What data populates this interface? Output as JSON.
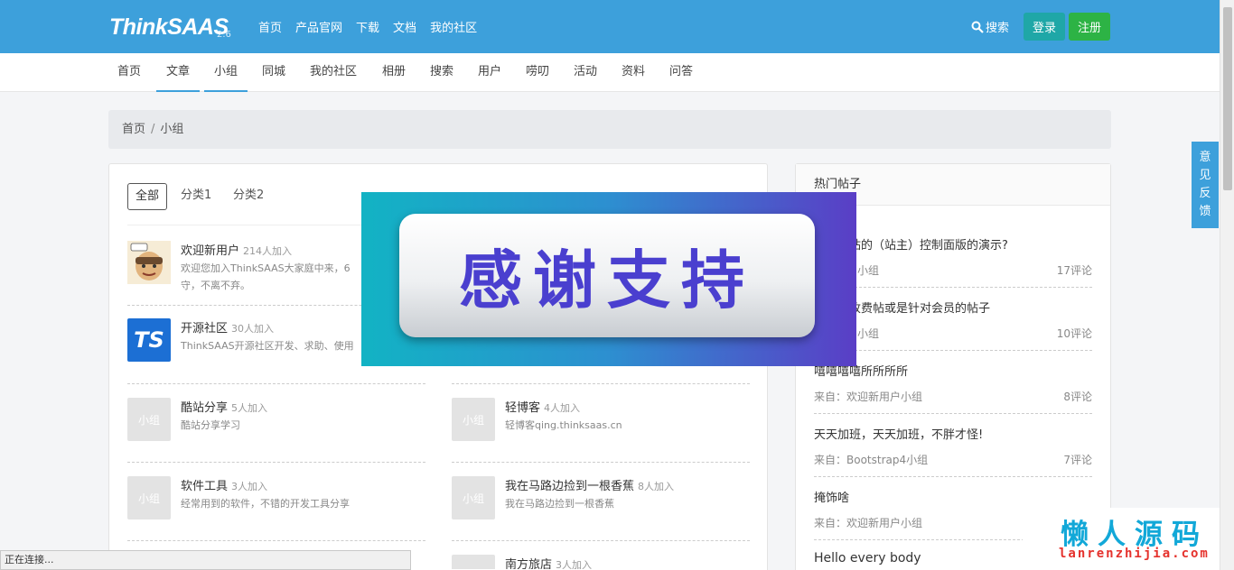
{
  "header": {
    "logo": "ThinkSAAS",
    "version": "2.6",
    "nav": [
      "首页",
      "产品官网",
      "下载",
      "文档",
      "我的社区"
    ],
    "search": "搜索",
    "login": "登录",
    "register": "注册",
    "bg_color": "#3da0db"
  },
  "subnav": [
    "首页",
    "文章",
    "小组",
    "同城",
    "我的社区",
    "相册",
    "搜索",
    "用户",
    "唠叨",
    "活动",
    "资料",
    "问答"
  ],
  "breadcrumb": {
    "home": "首页",
    "sep": "/",
    "current": "小组"
  },
  "filters": [
    "全部",
    "分类1",
    "分类2"
  ],
  "groups": [
    {
      "name": "欢迎新用户",
      "count": "214人加入",
      "desc": "欢迎您加入ThinkSAAS大家庭中来，6",
      "desc2": "守，不离不弃。",
      "thumb": ""
    },
    {
      "name": "开源社区",
      "count": "30人加入",
      "desc": "ThinkSAAS开源社区开发、求助、使用",
      "thumb": "TS"
    },
    {
      "name": "酷站分享",
      "count": "5人加入",
      "desc": "酷站分享学习",
      "thumb": "小组"
    },
    {
      "name": "轻博客",
      "count": "4人加入",
      "desc": "轻博客qing.thinksaas.cn",
      "thumb": "小组"
    },
    {
      "name": "软件工具",
      "count": "3人加入",
      "desc": "经常用到的软件，不错的开发工具分享",
      "thumb": "小组"
    },
    {
      "name": "我在马路边捡到一根香蕉",
      "count": "8人加入",
      "desc": "我在马路边捡到一根香蕉",
      "thumb": "小组"
    },
    {
      "name": "南方旅店",
      "count": "3人加入",
      "desc": "",
      "thumb": "小组"
    }
  ],
  "sidebar": {
    "title": "热门帖子",
    "posts": [
      {
        "title": "这个网站的（站主）控制面版的演示?",
        "from": "迎新用户小组",
        "comments": "17评论"
      },
      {
        "title": "不能设收费帖或是针对会员的帖子",
        "from": "迎新用户小组",
        "comments": "10评论"
      },
      {
        "title": "嘻嘻嘻嘻所所所所",
        "from": "来自：欢迎新用户小组",
        "comments": "8评论"
      },
      {
        "title": "天天加班，天天加班，不胖才怪!",
        "from": "来自：Bootstrap4小组",
        "comments": "7评论"
      },
      {
        "title": "掩饰啥",
        "from": "来自：欢迎新用户小组",
        "comments": ""
      },
      {
        "title": "Hello every body",
        "from": "",
        "comments": ""
      }
    ]
  },
  "feedback": "意见反馈",
  "banner": {
    "text": "感谢支持"
  },
  "status_bar": "正在连接...",
  "watermark": {
    "main": "懒人源码",
    "sub": "lanrenzhijia.com"
  }
}
